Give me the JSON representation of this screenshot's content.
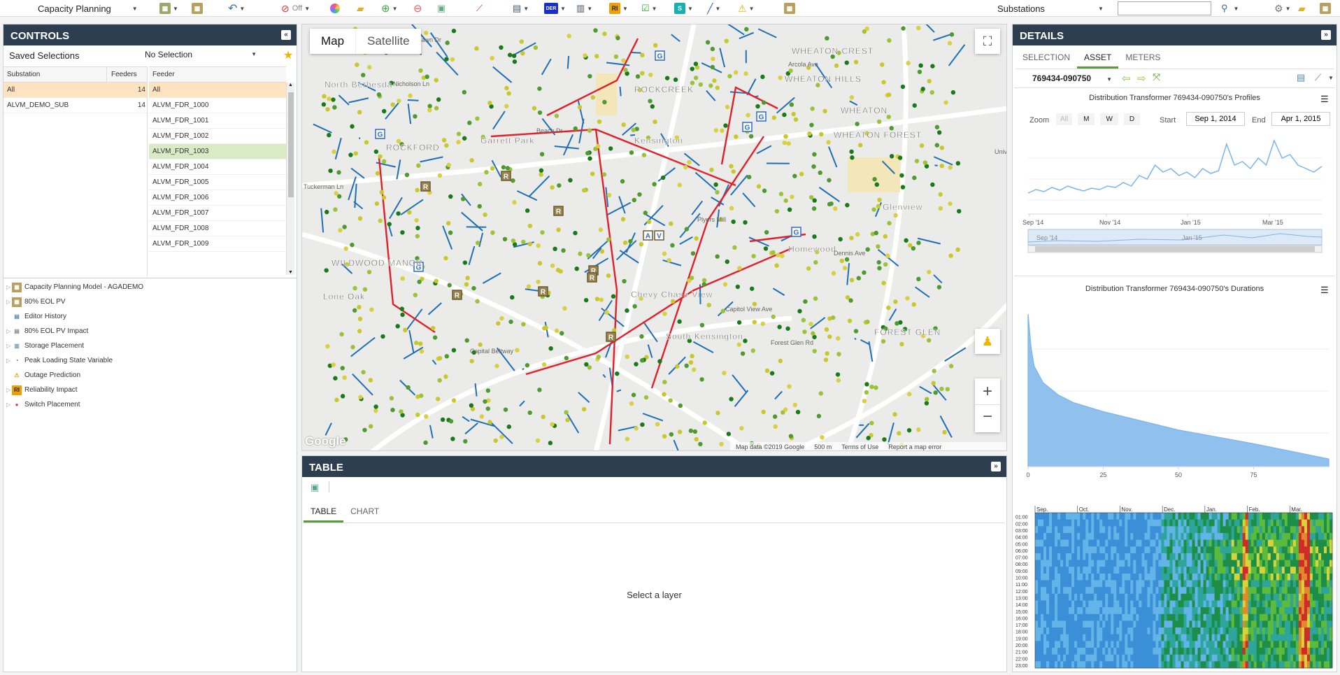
{
  "toolbar": {
    "model_select": "Capacity Planning",
    "off_label": "Off",
    "layer_select": "Substations",
    "search_value": ""
  },
  "controls": {
    "title": "CONTROLS",
    "saved_selections_label": "Saved Selections",
    "saved_selections_value": "No Selection",
    "substation_header": "Substation",
    "feeders_header": "Feeders",
    "feeder_header": "Feeder",
    "substations": [
      {
        "name": "All",
        "feeders": "14"
      },
      {
        "name": "ALVM_DEMO_SUB",
        "feeders": "14"
      }
    ],
    "feeders": [
      "All",
      "ALVM_FDR_1000",
      "ALVM_FDR_1001",
      "ALVM_FDR_1002",
      "ALVM_FDR_1003",
      "ALVM_FDR_1004",
      "ALVM_FDR_1005",
      "ALVM_FDR_1006",
      "ALVM_FDR_1007",
      "ALVM_FDR_1008",
      "ALVM_FDR_1009"
    ],
    "layers": [
      {
        "label": "Capacity Planning Model - AGADEMO",
        "icon": "capacity-model-icon"
      },
      {
        "label": "80% EOL PV",
        "icon": "pv-icon"
      },
      {
        "label": "Editor History",
        "icon": "history-icon"
      },
      {
        "label": "80% EOL PV Impact",
        "icon": "document-icon"
      },
      {
        "label": "Storage Placement",
        "icon": "storage-icon"
      },
      {
        "label": "Peak Loading State Variable",
        "icon": "gauge-icon"
      },
      {
        "label": "Outage Prediction",
        "icon": "warning-icon"
      },
      {
        "label": "Reliability Impact",
        "icon": "ri-icon"
      },
      {
        "label": "Switch Placement",
        "icon": "switch-icon"
      }
    ]
  },
  "map": {
    "tab_map": "Map",
    "tab_satellite": "Satellite",
    "attribution": "Map data ©2019 Google",
    "scale": "500 m",
    "terms": "Terms of Use",
    "report": "Report a map error",
    "google": "Google",
    "places": [
      {
        "name": "North Bethesda"
      },
      {
        "name": "WHEATON CREST"
      },
      {
        "name": "WHEATON HILLS"
      },
      {
        "name": "WHEATON"
      },
      {
        "name": "WHEATON FOREST"
      },
      {
        "name": "ROCKCREEK"
      },
      {
        "name": "Garrett Park"
      },
      {
        "name": "Kensington"
      },
      {
        "name": "Glenview"
      },
      {
        "name": "WILDWOOD MANOR"
      },
      {
        "name": "Lone Oak"
      },
      {
        "name": "Chevy Chase View"
      },
      {
        "name": "South Kensington"
      },
      {
        "name": "FOREST GLEN"
      },
      {
        "name": "Homewood"
      },
      {
        "name": "ROCKFORD"
      }
    ],
    "roads": [
      "Parklawn Dr",
      "Nicholson Ln",
      "Tuckerman Ln",
      "Arcola Ave",
      "Beach Dr",
      "Plyers Mill",
      "Dennis Ave",
      "Forest Glen Rd",
      "Capitol View Ave",
      "Capital Beltway",
      "Univ"
    ]
  },
  "table": {
    "title": "TABLE",
    "tab_table": "TABLE",
    "tab_chart": "CHART",
    "empty_message": "Select a layer"
  },
  "details": {
    "title": "DETAILS",
    "tabs": [
      "SELECTION",
      "ASSET",
      "METERS"
    ],
    "asset_id": "769434-090750",
    "profile_title": "Distribution Transformer 769434-090750's Profiles",
    "zoom_label": "Zoom",
    "zoom_buttons": [
      "All",
      "M",
      "W",
      "D"
    ],
    "start_label": "Start",
    "start_value": "Sep 1, 2014",
    "end_label": "End",
    "end_value": "Apr 1, 2015",
    "duration_title": "Distribution Transformer 769434-090750's Durations",
    "heatmap_months": [
      "Sep.",
      "Oct.",
      "Nov.",
      "Dec.",
      "Jan.",
      "Feb.",
      "Mar."
    ],
    "heatmap_hours": [
      "01:00",
      "02:00",
      "03:00",
      "04:00",
      "05:00",
      "06:00",
      "07:00",
      "08:00",
      "09:00",
      "10:00",
      "11:00",
      "12:00",
      "13:00",
      "14:00",
      "15:00",
      "16:00",
      "17:00",
      "18:00",
      "19:00",
      "20:00",
      "21:00",
      "22:00",
      "23:00"
    ]
  },
  "chart_data": [
    {
      "type": "line",
      "title": "Distribution Transformer 769434-090750's Profiles",
      "x_tick_labels": [
        "Sep '14",
        "Nov '14",
        "Jan '15",
        "Mar '15"
      ],
      "navigator_labels": [
        "Sep '14",
        "Jan '15"
      ],
      "series": [
        {
          "values": [
            0.2,
            0.25,
            0.22,
            0.28,
            0.24,
            0.3,
            0.26,
            0.23,
            0.27,
            0.25,
            0.3,
            0.28,
            0.35,
            0.3,
            0.45,
            0.4,
            0.6,
            0.5,
            0.55,
            0.45,
            0.5,
            0.42,
            0.55,
            0.48,
            0.52,
            0.9,
            0.6,
            0.65,
            0.55,
            0.7,
            0.6,
            0.95,
            0.7,
            0.75,
            0.6,
            0.55,
            0.5,
            0.58
          ]
        }
      ]
    },
    {
      "type": "area",
      "title": "Distribution Transformer 769434-090750's Durations",
      "x": [
        0,
        1,
        2,
        5,
        10,
        15,
        25,
        50,
        75,
        100
      ],
      "y": [
        1.0,
        0.78,
        0.66,
        0.55,
        0.47,
        0.42,
        0.36,
        0.24,
        0.15,
        0.05
      ],
      "x_tick_labels": [
        "0",
        "25",
        "50",
        "75"
      ],
      "xlim": [
        0,
        100
      ]
    }
  ]
}
